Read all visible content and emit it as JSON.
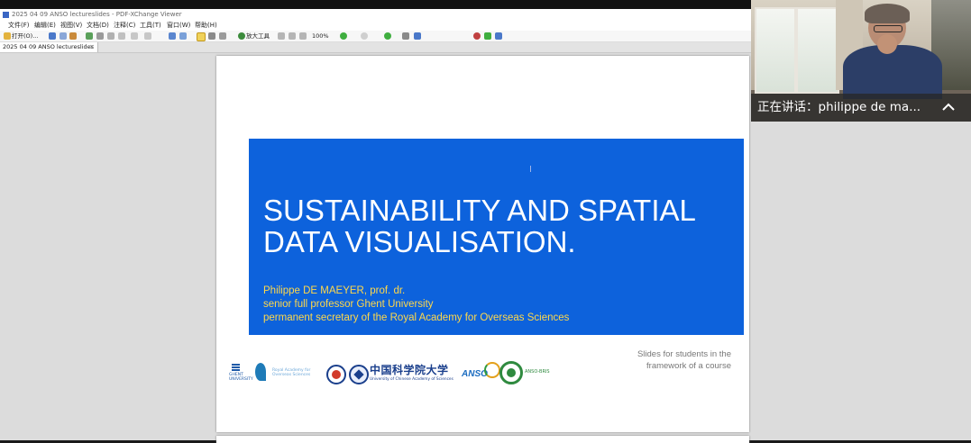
{
  "window": {
    "title": "2025 04 09 ANSO lectureslides - PDF-XChange Viewer"
  },
  "menu": {
    "items": [
      "文件(F)",
      "编辑(E)",
      "视图(V)",
      "文档(D)",
      "注释(C)",
      "工具(T)",
      "窗口(W)",
      "帮助(H)"
    ]
  },
  "toolbar": {
    "open_label": "打开(O)...",
    "zoom_tool_label": "放大工具",
    "zoom_value": "100%"
  },
  "tabs": [
    {
      "label": "2025 04 09 ANSO lectureslides"
    }
  ],
  "slide": {
    "title_line1": "SUSTAINABILITY AND SPATIAL",
    "title_line2": "DATA VISUALISATION.",
    "author_line1": "Philippe DE MAEYER, prof. dr.",
    "author_line2": "senior full professor Ghent University",
    "author_line3": "permanent secretary of the Royal Academy for Overseas Sciences",
    "note_line1": "Slides for students in the",
    "note_line2": "framework of a course",
    "logos": {
      "ghent_line1": "GHENT",
      "ghent_line2": "UNIVERSITY",
      "royal_line1": "Royal Academy for",
      "royal_line2": "Overseas Sciences",
      "ucas_cn": "中国科学院大学",
      "ucas_en": "University of Chinese Academy of Sciences",
      "anso": "ANSO",
      "bri": "ANSO-BRIS"
    }
  },
  "video": {
    "speaker_label": "正在讲话：philippe de ma..."
  },
  "colors": {
    "slide_blue": "#0d62dc",
    "slide_title": "#ffffff",
    "slide_author": "#ffd84a"
  }
}
